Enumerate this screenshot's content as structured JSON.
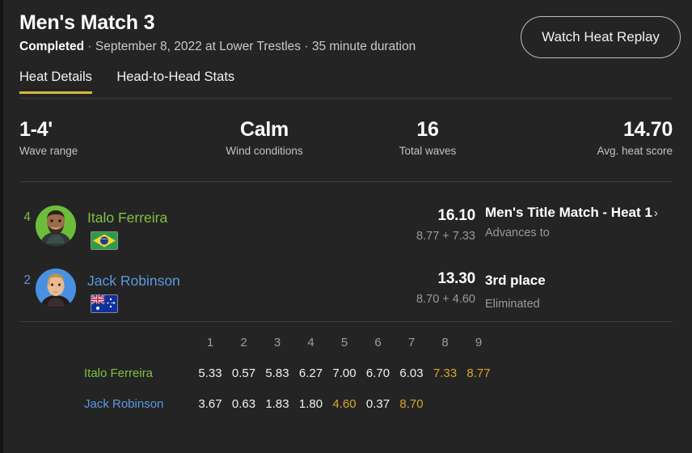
{
  "header": {
    "title": "Men's Match 3",
    "status": "Completed",
    "meta": "September 8, 2022 at Lower Trestles · 35 minute duration",
    "replay_button": "Watch Heat Replay"
  },
  "tabs": [
    {
      "label": "Heat Details",
      "active": true
    },
    {
      "label": "Head-to-Head Stats",
      "active": false
    }
  ],
  "stats": [
    {
      "value": "1-4'",
      "label": "Wave range"
    },
    {
      "value": "Calm",
      "label": "Wind conditions"
    },
    {
      "value": "16",
      "label": "Total waves"
    },
    {
      "value": "14.70",
      "label": "Avg. heat score"
    }
  ],
  "surfers": [
    {
      "seed": "4",
      "name": "Italo Ferreira",
      "country": "brazil",
      "jersey_color": "#6cbe3a",
      "name_color": "#7fc142",
      "score": "16.10",
      "breakdown": "8.77 + 7.33",
      "result_title": "Men's Title Match - Heat 1",
      "result_chevron": "›",
      "result_sub": "Advances to"
    },
    {
      "seed": "2",
      "name": "Jack Robinson",
      "country": "australia",
      "jersey_color": "#4a90e2",
      "name_color": "#5a9ae0",
      "score": "13.30",
      "breakdown": "8.70 + 4.60",
      "result_title": "3rd place",
      "result_chevron": "",
      "result_sub": "Eliminated"
    }
  ],
  "wave_table": {
    "columns": [
      "1",
      "2",
      "3",
      "4",
      "5",
      "6",
      "7",
      "8",
      "9"
    ],
    "rows": [
      {
        "name": "Italo Ferreira",
        "name_color": "#7fc142",
        "scores": [
          "5.33",
          "0.57",
          "5.83",
          "6.27",
          "7.00",
          "6.70",
          "6.03",
          "7.33",
          "8.77"
        ],
        "highlighted": [
          7,
          8
        ]
      },
      {
        "name": "Jack Robinson",
        "name_color": "#5a9ae0",
        "scores": [
          "3.67",
          "0.63",
          "1.83",
          "1.80",
          "4.60",
          "0.37",
          "8.70"
        ],
        "highlighted": [
          4,
          6
        ]
      }
    ],
    "highlight_color": "#d8a72c"
  }
}
